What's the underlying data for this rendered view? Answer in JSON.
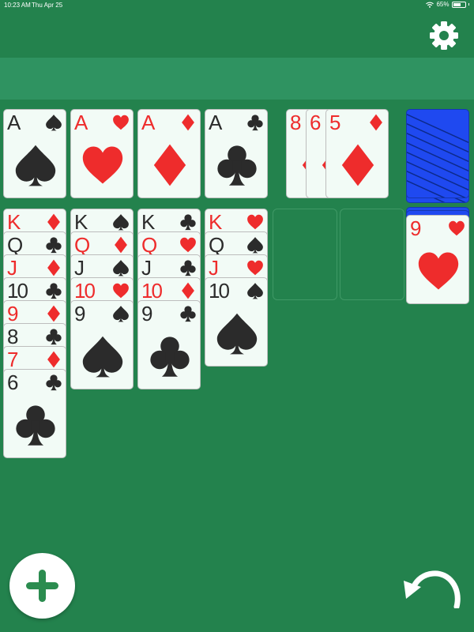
{
  "status_bar": {
    "time": "10:23 AM",
    "date": "Thu Apr 25",
    "battery": "65%",
    "battery_level": 0.65
  },
  "icons": {
    "settings": "gear-icon",
    "new_game": "plus-icon",
    "undo": "undo-arrow-icon",
    "wifi": "wifi-icon"
  },
  "colors": {
    "table": "#23824d",
    "info_bar": "#2f9361",
    "red_suit": "#ee2c2c",
    "black_suit": "#2b2b2b",
    "card_back": "#1f49f0",
    "button_icon": "#2b8c4f"
  },
  "foundations": [
    {
      "rank": "A",
      "suit": "spades"
    },
    {
      "rank": "A",
      "suit": "hearts"
    },
    {
      "rank": "A",
      "suit": "diamonds"
    },
    {
      "rank": "A",
      "suit": "clubs"
    }
  ],
  "fan": [
    {
      "rank": "8",
      "suit": "diamonds"
    },
    {
      "rank": "6",
      "suit": "diamonds"
    },
    {
      "rank": "5",
      "suit": "diamonds"
    }
  ],
  "tableau": [
    [
      {
        "rank": "K",
        "suit": "diamonds"
      },
      {
        "rank": "Q",
        "suit": "clubs"
      },
      {
        "rank": "J",
        "suit": "diamonds"
      },
      {
        "rank": "10",
        "suit": "clubs"
      },
      {
        "rank": "9",
        "suit": "diamonds"
      },
      {
        "rank": "8",
        "suit": "clubs"
      },
      {
        "rank": "7",
        "suit": "diamonds"
      },
      {
        "rank": "6",
        "suit": "clubs"
      }
    ],
    [
      {
        "rank": "K",
        "suit": "spades"
      },
      {
        "rank": "Q",
        "suit": "diamonds"
      },
      {
        "rank": "J",
        "suit": "spades"
      },
      {
        "rank": "10",
        "suit": "hearts"
      },
      {
        "rank": "9",
        "suit": "spades"
      }
    ],
    [
      {
        "rank": "K",
        "suit": "clubs"
      },
      {
        "rank": "Q",
        "suit": "hearts"
      },
      {
        "rank": "J",
        "suit": "clubs"
      },
      {
        "rank": "10",
        "suit": "diamonds"
      },
      {
        "rank": "9",
        "suit": "clubs"
      }
    ],
    [
      {
        "rank": "K",
        "suit": "hearts"
      },
      {
        "rank": "Q",
        "suit": "spades"
      },
      {
        "rank": "J",
        "suit": "hearts"
      },
      {
        "rank": "10",
        "suit": "spades"
      }
    ],
    [],
    []
  ],
  "stock": {
    "face_down": true
  },
  "waste": {
    "rank": "9",
    "suit": "hearts"
  }
}
